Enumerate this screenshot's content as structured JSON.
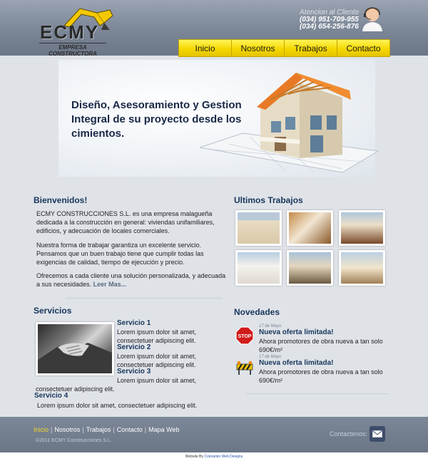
{
  "header": {
    "logo_text": "ECMY",
    "logo_sub": "EMPRESA CONSTRUCTORA",
    "contact_title": "Atencion al Cliente",
    "phone1": "(034) 951-709-955",
    "phone2": "(034) 654-256-876"
  },
  "nav": {
    "items": [
      "Inicio",
      "Nosotros",
      "Trabajos",
      "Contacto"
    ]
  },
  "hero": {
    "text": "Diseño, Asesoramiento y Gestion Integral de su proyecto desde los cimientos."
  },
  "welcome": {
    "title": "Bienvenidos!",
    "p1": "ECMY CONSTRUCCIONES S.L. es una empresa malagueña dedicada a la construcción en general: viviendas unifamiliares, edificios, y adecuación de locales comerciales.",
    "p2": "Nuestra forma de trabajar garantiza un excelente servicio. Pensamos que un buen trabajo tiene que cumplir todas las exigencias de calidad, tiempo de ejecución y precio.",
    "p3": "Ofrecemos a cada cliente una solución personalizada, y adecuada a sus necesidades.",
    "readmore": "Leer Mas..."
  },
  "works": {
    "title": "Ultimos Trabajos"
  },
  "services": {
    "title": "Servicios",
    "s1_title": "Servicio 1",
    "s1_text": "Lorem ipsum dolor sit amet, consectetuer adipiscing elit.",
    "s2_title": "Servicio 2",
    "s2_text": "Lorem ipsum dolor sit amet, consectetuer adipiscing elit.",
    "s3_title": "Servicio 3",
    "s3_text_a": "Lorem ipsum dolor sit amet,",
    "s3_text_b": "consectetuer adipiscing elit.",
    "s4_title": "Servicio 4",
    "s4_text": "Lorem ipsum dolor sit amet, consectetuer adipiscing elit."
  },
  "news": {
    "title": "Novedades",
    "items": [
      {
        "date": "17 de Mayo",
        "title": "Nueva oferta limitada!",
        "body": "Ahora promotores de obra nueva a tan solo 690€/m²"
      },
      {
        "date": "17 de Mayo",
        "title": "Nueva oferta limitada!",
        "body": "Ahora promotores de obra nueva a tan solo 690€/m²"
      }
    ]
  },
  "footer": {
    "links": [
      "Inicio",
      "Nosotros",
      "Trabajos",
      "Contacto",
      "Mapa Web"
    ],
    "separator": "|",
    "copyright": "©2011 ECMY Construcciones S.L.",
    "contact_label": "Contactenos:",
    "credit_prefix": "Website By",
    "credit_link": "Coloramio Web Designs"
  },
  "colors": {
    "accent": "#f5d800",
    "heading": "#17355a",
    "header_bg": "#7d8898"
  }
}
